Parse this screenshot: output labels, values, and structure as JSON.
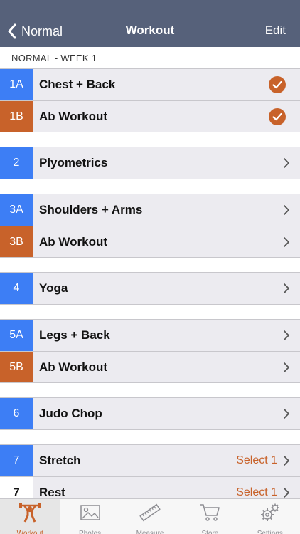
{
  "navbar": {
    "back_label": "Normal",
    "title": "Workout",
    "edit_label": "Edit"
  },
  "section_header": "NORMAL - WEEK 1",
  "colors": {
    "nav_bg": "#56617a",
    "blue": "#3d7ef5",
    "orange": "#c8622a",
    "row_bg": "#ecebf0"
  },
  "groups": [
    [
      {
        "badge": "1A",
        "badge_color": "blue",
        "title": "Chest + Back",
        "accessory": "check"
      },
      {
        "badge": "1B",
        "badge_color": "orange",
        "title": "Ab Workout",
        "accessory": "check"
      }
    ],
    [
      {
        "badge": "2",
        "badge_color": "blue",
        "title": "Plyometrics",
        "accessory": "chevron"
      }
    ],
    [
      {
        "badge": "3A",
        "badge_color": "blue",
        "title": "Shoulders + Arms",
        "accessory": "chevron"
      },
      {
        "badge": "3B",
        "badge_color": "orange",
        "title": "Ab Workout",
        "accessory": "chevron"
      }
    ],
    [
      {
        "badge": "4",
        "badge_color": "blue",
        "title": "Yoga",
        "accessory": "chevron"
      }
    ],
    [
      {
        "badge": "5A",
        "badge_color": "blue",
        "title": "Legs + Back",
        "accessory": "chevron"
      },
      {
        "badge": "5B",
        "badge_color": "orange",
        "title": "Ab Workout",
        "accessory": "chevron"
      }
    ],
    [
      {
        "badge": "6",
        "badge_color": "blue",
        "title": "Judo Chop",
        "accessory": "chevron"
      }
    ],
    [
      {
        "badge": "7",
        "badge_color": "blue",
        "title": "Stretch",
        "accessory": "chevron",
        "detail": "Select 1"
      },
      {
        "badge": "7",
        "badge_color": "white",
        "title": "Rest",
        "accessory": "chevron",
        "detail": "Select 1"
      }
    ]
  ],
  "tabs": [
    {
      "label": "Workout",
      "icon": "weightlifter-icon",
      "active": true
    },
    {
      "label": "Photos",
      "icon": "photo-icon",
      "active": false
    },
    {
      "label": "Measure",
      "icon": "ruler-icon",
      "active": false
    },
    {
      "label": "Store",
      "icon": "cart-icon",
      "active": false
    },
    {
      "label": "Settings",
      "icon": "gears-icon",
      "active": false
    }
  ]
}
